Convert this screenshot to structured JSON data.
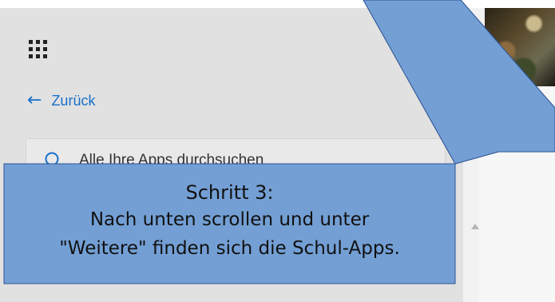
{
  "launcher": {
    "back_label": "Zurück",
    "search_placeholder": "Alle Ihre Apps durchsuchen"
  },
  "callout": {
    "title": "Schritt 3:",
    "line1": "Nach unten scrollen und unter",
    "line2": "\"Weitere\" finden sich die Schul-Apps.",
    "fill": "#739fd4",
    "border": "#2f5597"
  },
  "icons": {
    "waffle": "app-launcher-grid-icon",
    "back": "left-arrow-icon",
    "search": "search-icon",
    "scroll": "scroll-up-arrow-icon"
  }
}
